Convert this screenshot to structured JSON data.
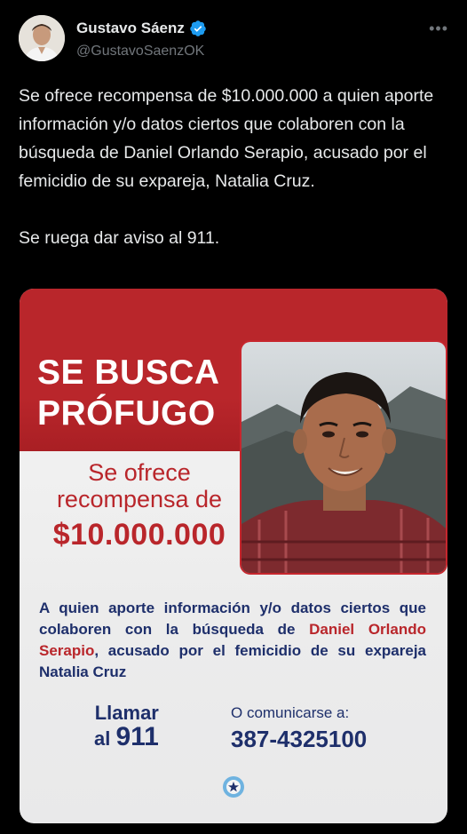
{
  "post": {
    "author_name": "Gustavo Sáenz",
    "handle": "@GustavoSaenzOK",
    "more_icon": "more-horizontal-icon",
    "text": "Se ofrece recompensa de $10.000.000 a quien aporte información y/o datos ciertos que colaboren con la búsqueda de Daniel Orlando Serapio, acusado por el femicidio de su expareja, Natalia Cruz.\n\nSe ruega dar aviso al 911."
  },
  "poster": {
    "headline_1": "SE BUSCA",
    "headline_2": "PRÓFUGO",
    "reward_label_1": "Se ofrece",
    "reward_label_2": "recompensa de",
    "reward_amount": "$10.000.000",
    "body_part1": "A quien aporte información y/o datos ciertos que colaboren con la búsqueda de ",
    "body_name": "Daniel Orlando Serapio",
    "body_part2": ", acusado por el femicidio de su expareja Natalia Cruz",
    "call_line1": "Llamar",
    "call_line2_prefix": "al ",
    "call_number": "911",
    "contact_label": "O comunicarse a:",
    "contact_number": "387-4325100"
  },
  "colors": {
    "accent_red": "#b9262b",
    "navy": "#1e2f6b",
    "verified_blue": "#1d9bf0"
  }
}
